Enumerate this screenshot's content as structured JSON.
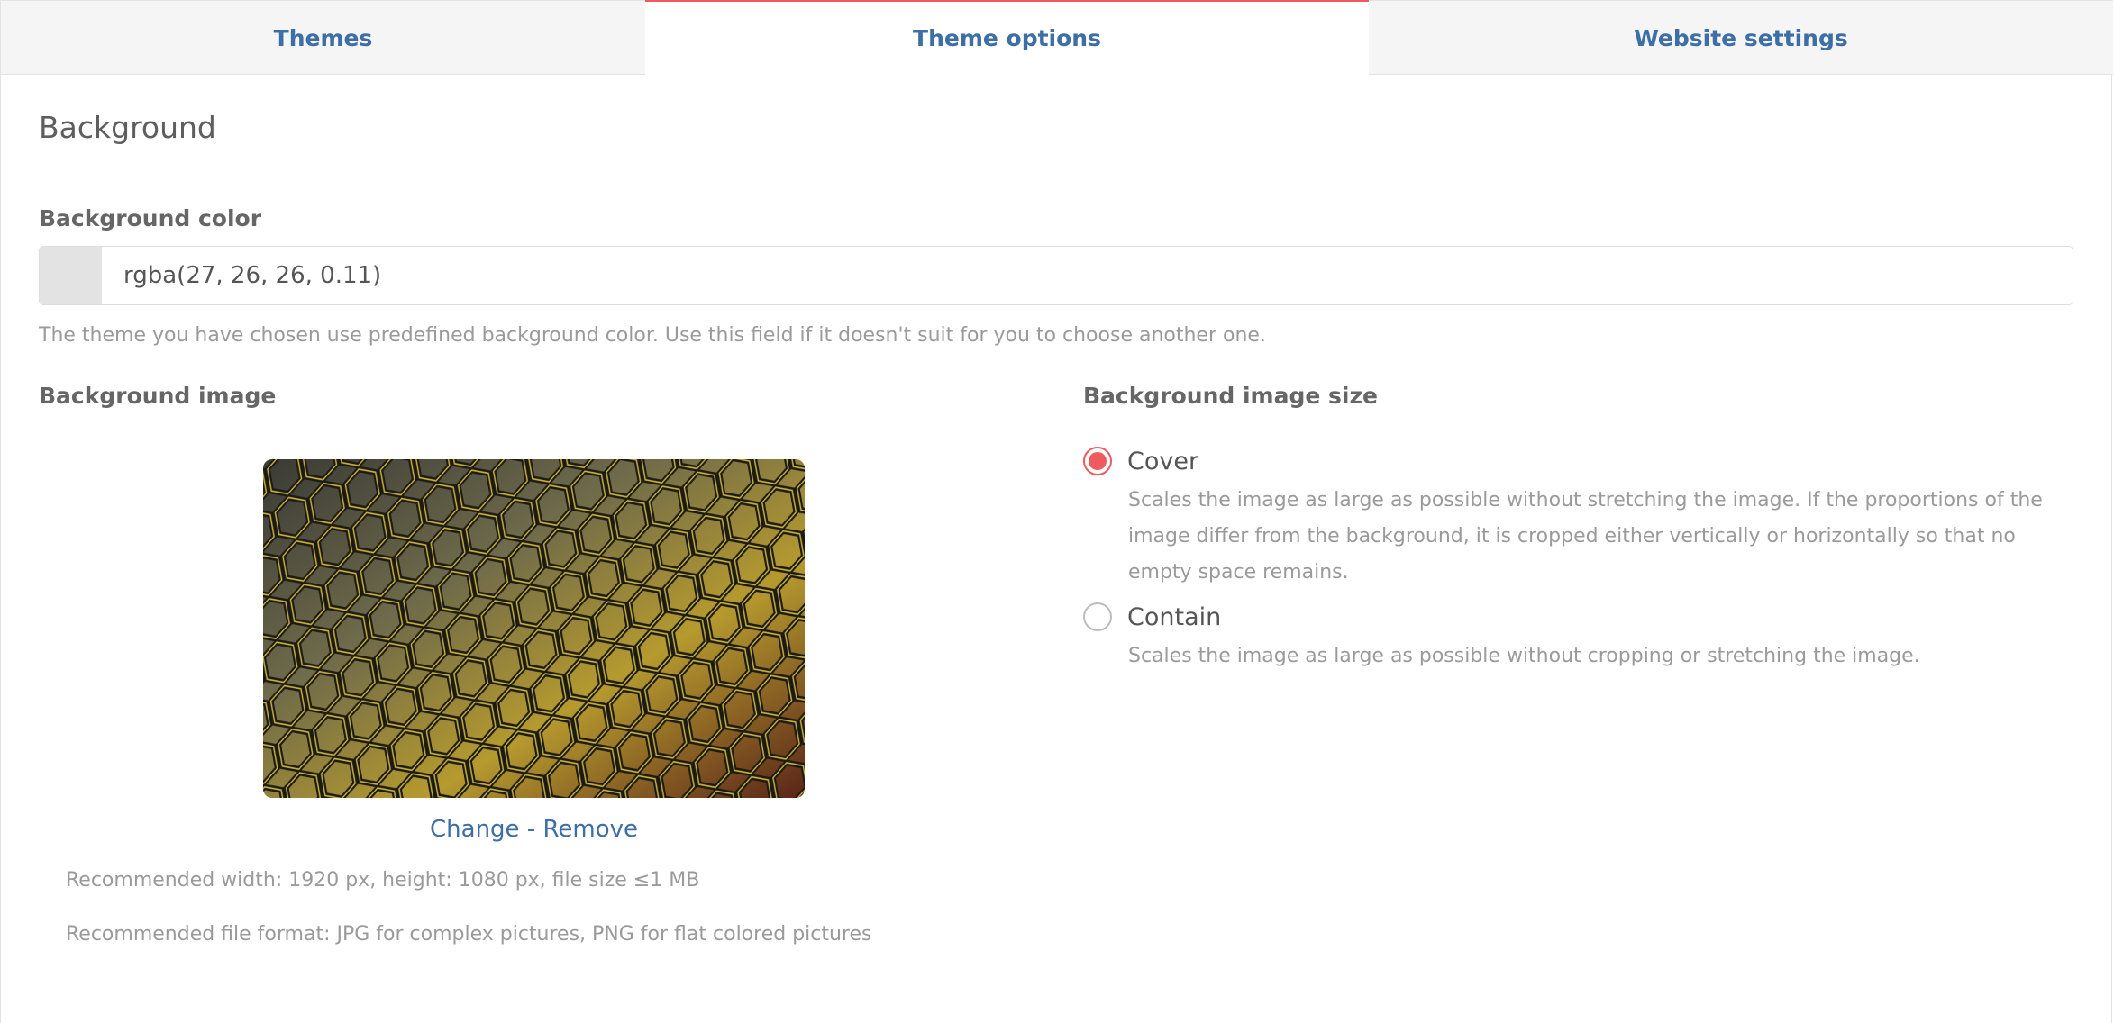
{
  "tabs": [
    {
      "label": "Themes"
    },
    {
      "label": "Theme options"
    },
    {
      "label": "Website settings"
    }
  ],
  "section": {
    "title": "Background"
  },
  "background_color": {
    "label": "Background color",
    "value": "rgba(27, 26, 26, 0.11)",
    "hint": "The theme you have chosen use predefined background color. Use this field if it doesn't suit for you to choose another one."
  },
  "background_image": {
    "label": "Background image",
    "change_label": "Change",
    "separator": " - ",
    "remove_label": "Remove",
    "recommend_size": "Recommended width: 1920 px, height: 1080 px, file size ≤1 MB",
    "recommend_format": "Recommended file format: JPG for complex pictures, PNG for flat colored pictures"
  },
  "background_image_size": {
    "label": "Background image size",
    "selected": "cover",
    "options": [
      {
        "label": "Cover",
        "description": "Scales the image as large as possible without stretching the image. If the proportions of the image differ from the background, it is cropped either vertically or horizontally so that no empty space remains."
      },
      {
        "label": "Contain",
        "description": "Scales the image as large as possible without cropping or stretching the image."
      }
    ]
  },
  "colors": {
    "accent": "#ee5a5e",
    "link": "#3d6ea6",
    "swatch": "#e3e3e3"
  }
}
